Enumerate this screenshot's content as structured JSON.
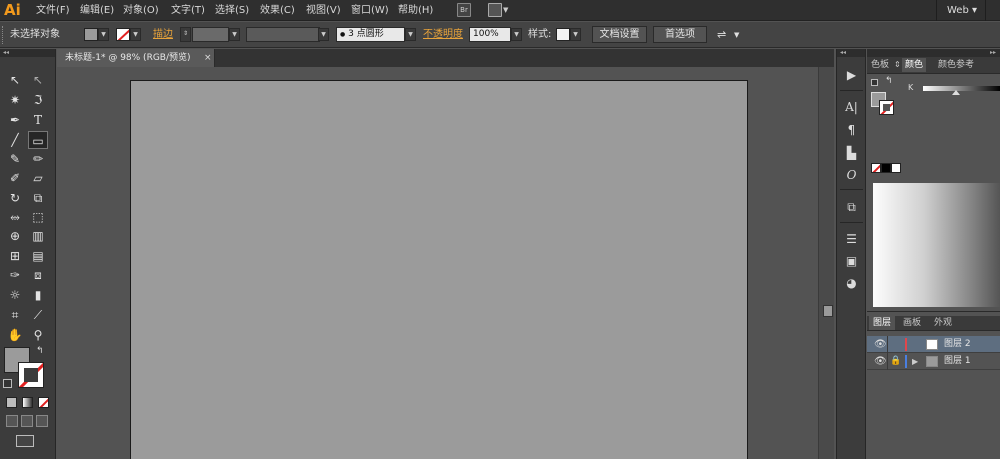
{
  "app": {
    "logo": "Ai"
  },
  "menu": {
    "items": [
      "文件(F)",
      "编辑(E)",
      "对象(O)",
      "文字(T)",
      "选择(S)",
      "效果(C)",
      "视图(V)",
      "窗口(W)",
      "帮助(H)"
    ],
    "bridge_icon": "Br",
    "workspace": "Web ▾"
  },
  "control_bar": {
    "selection_status": "未选择对象",
    "stroke_label": "描边",
    "brush_value": "3 点圆形",
    "opacity_label": "不透明度",
    "opacity_value": "100%",
    "style_label": "样式:",
    "doc_setup_button": "文档设置",
    "preferences_button": "首选项"
  },
  "document": {
    "tab_title": "未标题-1* @ 98% (RGB/预览)",
    "close_glyph": "×",
    "artboard_color": "#9b9b9b"
  },
  "color_panel": {
    "tabs": [
      "色板",
      "颜色",
      "颜色参考"
    ],
    "active_tab": "颜色",
    "channel_label": "K"
  },
  "layers_panel": {
    "tabs": [
      "图层",
      "画板",
      "外观"
    ],
    "active_tab": "图层",
    "layers": [
      {
        "name": "图层 2",
        "color": "#e0474c",
        "selected": true,
        "locked": false,
        "expandable": false
      },
      {
        "name": "图层 1",
        "color": "#4a7fe0",
        "selected": false,
        "locked": true,
        "expandable": true
      }
    ]
  },
  "colors": {
    "accent_link": "#e8a33a",
    "logo": "#f39a1d",
    "selection": "#5e6e80"
  }
}
